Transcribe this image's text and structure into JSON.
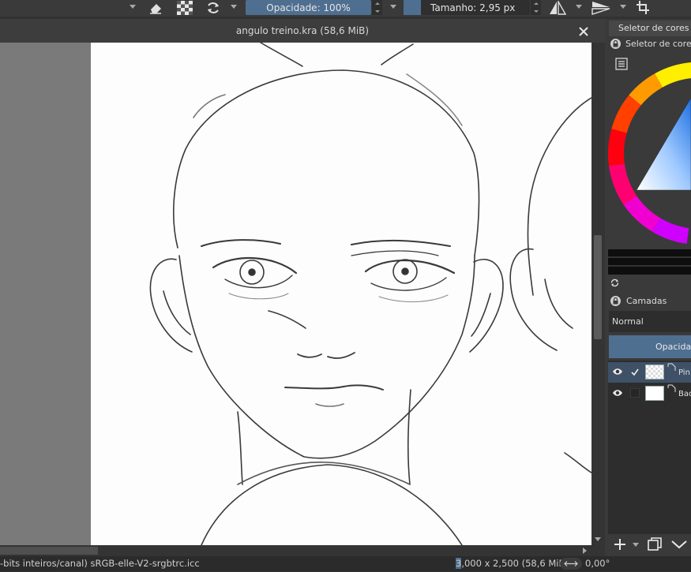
{
  "toolbar": {
    "opacity_label": "Opacidade: 100%",
    "size_label": "Tamanho: 2,95 px",
    "icons": [
      "eraser-icon",
      "alpha-lock-icon",
      "reload-preset-icon",
      "mirror-horizontal-icon",
      "mirror-vertical-icon",
      "wrap-around-icon"
    ]
  },
  "document": {
    "title": "angulo treino.kra (58,6 MiB)"
  },
  "status": {
    "color_info": "-bits inteiros/canal)  sRGB-elle-V2-srgbtrc.icc",
    "size_prefix": "3",
    "size_rest": ",000 x 2,500 (58,6 MiB)",
    "rotation": "0,00°"
  },
  "docker": {
    "color_tab_label": "Seletor de cores a",
    "color_panel_title": "Seletor de cores",
    "layers_title": "Camadas",
    "blend_mode": "Normal",
    "opacity_label": "Opacidade",
    "layers": [
      {
        "name": "Pin",
        "visible": true,
        "selected": true
      },
      {
        "name": "Bac",
        "visible": true,
        "selected": false
      }
    ]
  },
  "colors": {
    "accent": "#4f6f91",
    "panel": "#3a3a3a",
    "canvas": "#fdfdfd"
  }
}
